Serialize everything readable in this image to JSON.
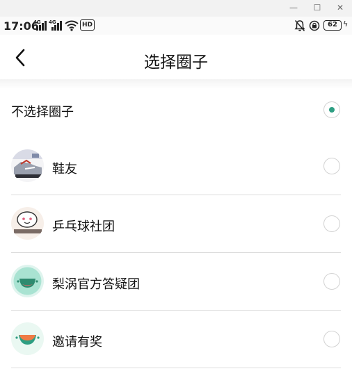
{
  "window": {
    "minimize_glyph": "—",
    "maximize_glyph": "☐",
    "close_glyph": "✕"
  },
  "status_bar": {
    "time": "17:06",
    "signal1_label": "4G",
    "signal2_label": "4G",
    "hd_label": "HD",
    "battery": "62"
  },
  "header": {
    "title": "选择圈子",
    "back_icon": "chevron-left-icon"
  },
  "options": {
    "none_label": "不选择圈子",
    "none_selected": true
  },
  "circles": [
    {
      "name": "鞋友",
      "avatar": "sneaker-avatar",
      "selected": false
    },
    {
      "name": "乒乓球社团",
      "avatar": "pingpong-club-avatar",
      "selected": false
    },
    {
      "name": "梨涡官方答疑团",
      "avatar": "liwo-official-avatar",
      "selected": false
    },
    {
      "name": "邀请有奖",
      "avatar": "invite-reward-avatar",
      "selected": false
    }
  ],
  "colors": {
    "accent": "#2e9e82",
    "divider": "#dcdcdc"
  }
}
